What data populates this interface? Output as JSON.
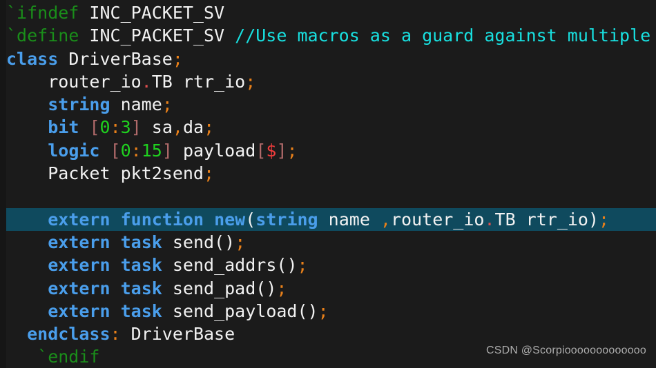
{
  "editor": {
    "language": "SystemVerilog",
    "background_color": "#1b1b1b",
    "highlight_color": "#0f4a5e",
    "colors": {
      "preprocessor": "#1a8e1a",
      "keyword": "#4a9eeb",
      "plain_text": "#f2f2f2",
      "comment": "#18e0e0",
      "punctuation": "#e8801a",
      "member_dot": "#e04f4f",
      "bracket": "#b06a6a",
      "number": "#1fd11f",
      "dollar": "#f03c3c"
    }
  },
  "code": {
    "lines": [
      {
        "index": 0,
        "highlighted": false,
        "tokens": [
          {
            "text": "`ifndef",
            "type": "pp"
          },
          {
            "text": " INC_PACKET_SV",
            "type": "plain"
          }
        ]
      },
      {
        "index": 1,
        "highlighted": false,
        "tokens": [
          {
            "text": "`define",
            "type": "pp"
          },
          {
            "text": " INC_PACKET_SV ",
            "type": "plain"
          },
          {
            "text": "//Use macros as a guard against multiple",
            "type": "comment"
          }
        ]
      },
      {
        "index": 2,
        "highlighted": false,
        "tokens": [
          {
            "text": "class",
            "type": "kw"
          },
          {
            "text": " DriverBase",
            "type": "plain"
          },
          {
            "text": ";",
            "type": "punc"
          }
        ]
      },
      {
        "index": 3,
        "highlighted": false,
        "tokens": [
          {
            "text": "    router_io",
            "type": "plain"
          },
          {
            "text": ".",
            "type": "dot"
          },
          {
            "text": "TB rtr_io",
            "type": "plain"
          },
          {
            "text": ";",
            "type": "punc"
          }
        ]
      },
      {
        "index": 4,
        "highlighted": false,
        "tokens": [
          {
            "text": "    ",
            "type": "plain"
          },
          {
            "text": "string",
            "type": "kw"
          },
          {
            "text": " name",
            "type": "plain"
          },
          {
            "text": ";",
            "type": "punc"
          }
        ]
      },
      {
        "index": 5,
        "highlighted": false,
        "tokens": [
          {
            "text": "    ",
            "type": "plain"
          },
          {
            "text": "bit",
            "type": "kw"
          },
          {
            "text": " ",
            "type": "plain"
          },
          {
            "text": "[",
            "type": "bracket"
          },
          {
            "text": "0",
            "type": "num"
          },
          {
            "text": ":",
            "type": "punc"
          },
          {
            "text": "3",
            "type": "num"
          },
          {
            "text": "]",
            "type": "bracket"
          },
          {
            "text": " sa",
            "type": "plain"
          },
          {
            "text": ",",
            "type": "punc"
          },
          {
            "text": "da",
            "type": "plain"
          },
          {
            "text": ";",
            "type": "punc"
          }
        ]
      },
      {
        "index": 6,
        "highlighted": false,
        "tokens": [
          {
            "text": "    ",
            "type": "plain"
          },
          {
            "text": "logic",
            "type": "kw"
          },
          {
            "text": " ",
            "type": "plain"
          },
          {
            "text": "[",
            "type": "bracket"
          },
          {
            "text": "0",
            "type": "num"
          },
          {
            "text": ":",
            "type": "punc"
          },
          {
            "text": "15",
            "type": "num"
          },
          {
            "text": "]",
            "type": "bracket"
          },
          {
            "text": " payload",
            "type": "plain"
          },
          {
            "text": "[",
            "type": "bracket"
          },
          {
            "text": "$",
            "type": "dollar"
          },
          {
            "text": "]",
            "type": "bracket"
          },
          {
            "text": ";",
            "type": "punc"
          }
        ]
      },
      {
        "index": 7,
        "highlighted": false,
        "tokens": [
          {
            "text": "    Packet pkt2send",
            "type": "plain"
          },
          {
            "text": ";",
            "type": "punc"
          }
        ]
      },
      {
        "index": 8,
        "highlighted": false,
        "tokens": []
      },
      {
        "index": 9,
        "highlighted": true,
        "tokens": [
          {
            "text": "    ",
            "type": "plain"
          },
          {
            "text": "extern",
            "type": "kw"
          },
          {
            "text": " ",
            "type": "plain"
          },
          {
            "text": "function",
            "type": "kw"
          },
          {
            "text": " ",
            "type": "plain"
          },
          {
            "text": "new",
            "type": "kw2"
          },
          {
            "text": "(",
            "type": "paren"
          },
          {
            "text": "string",
            "type": "kw"
          },
          {
            "text": " name ",
            "type": "plain"
          },
          {
            "text": ",",
            "type": "punc"
          },
          {
            "text": "router_io",
            "type": "plain"
          },
          {
            "text": ".",
            "type": "dot"
          },
          {
            "text": "TB rtr_io",
            "type": "plain"
          },
          {
            "text": ")",
            "type": "paren"
          },
          {
            "text": ";",
            "type": "punc"
          }
        ]
      },
      {
        "index": 10,
        "highlighted": false,
        "tokens": [
          {
            "text": "    ",
            "type": "plain"
          },
          {
            "text": "extern",
            "type": "kw"
          },
          {
            "text": " ",
            "type": "plain"
          },
          {
            "text": "task",
            "type": "kw"
          },
          {
            "text": " send",
            "type": "plain"
          },
          {
            "text": "()",
            "type": "paren"
          },
          {
            "text": ";",
            "type": "punc"
          }
        ]
      },
      {
        "index": 11,
        "highlighted": false,
        "tokens": [
          {
            "text": "    ",
            "type": "plain"
          },
          {
            "text": "extern",
            "type": "kw"
          },
          {
            "text": " ",
            "type": "plain"
          },
          {
            "text": "task",
            "type": "kw"
          },
          {
            "text": " send_addrs",
            "type": "plain"
          },
          {
            "text": "()",
            "type": "paren"
          },
          {
            "text": ";",
            "type": "punc"
          }
        ]
      },
      {
        "index": 12,
        "highlighted": false,
        "tokens": [
          {
            "text": "    ",
            "type": "plain"
          },
          {
            "text": "extern",
            "type": "kw"
          },
          {
            "text": " ",
            "type": "plain"
          },
          {
            "text": "task",
            "type": "kw"
          },
          {
            "text": " send_pad",
            "type": "plain"
          },
          {
            "text": "()",
            "type": "paren"
          },
          {
            "text": ";",
            "type": "punc"
          }
        ]
      },
      {
        "index": 13,
        "highlighted": false,
        "tokens": [
          {
            "text": "    ",
            "type": "plain"
          },
          {
            "text": "extern",
            "type": "kw"
          },
          {
            "text": " ",
            "type": "plain"
          },
          {
            "text": "task",
            "type": "kw"
          },
          {
            "text": " send_payload",
            "type": "plain"
          },
          {
            "text": "()",
            "type": "paren"
          },
          {
            "text": ";",
            "type": "punc"
          }
        ]
      },
      {
        "index": 14,
        "highlighted": false,
        "tokens": [
          {
            "text": "  ",
            "type": "plain"
          },
          {
            "text": "endclass",
            "type": "kw"
          },
          {
            "text": ":",
            "type": "punc"
          },
          {
            "text": " DriverBase",
            "type": "plain"
          }
        ]
      },
      {
        "index": 15,
        "highlighted": false,
        "tokens": [
          {
            "text": "   ",
            "type": "plain"
          },
          {
            "text": "`endif",
            "type": "pp"
          }
        ]
      }
    ]
  },
  "watermark": {
    "text": "CSDN @Scorpiooooooooooooo"
  }
}
